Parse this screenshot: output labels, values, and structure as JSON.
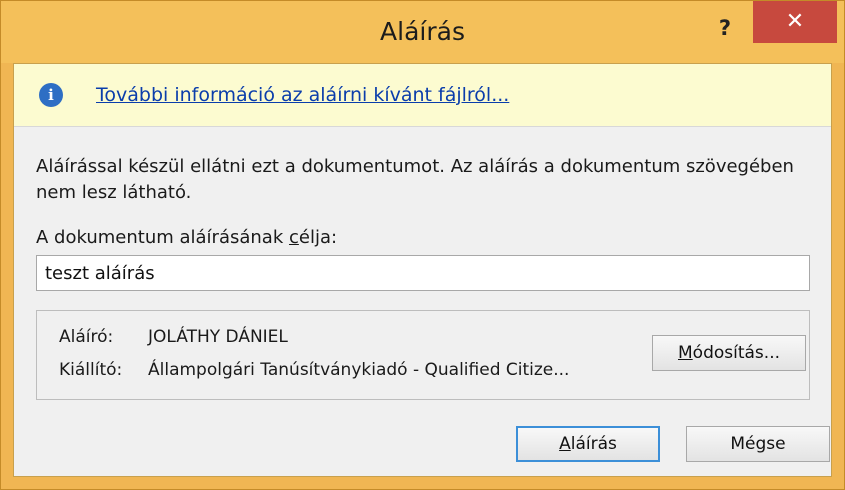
{
  "window": {
    "title": "Aláírás",
    "help_label": "?",
    "close_label": "✕"
  },
  "infobar": {
    "icon": "info-icon",
    "icon_glyph": "i",
    "link_text": "További információ az aláírni kívánt fájlról..."
  },
  "description": "Aláírással készül ellátni ezt a dokumentumot. Az aláírás a dokumentum szövegében nem lesz látható.",
  "purpose": {
    "label_pre": "A dokumentum aláírásának ",
    "label_accel": "c",
    "label_post": "élja:",
    "value": "teszt aláírás"
  },
  "signer": {
    "signer_label": "Aláíró:",
    "signer_value": "JOLÁTHY DÁNIEL",
    "issuer_label": "Kiállító:",
    "issuer_value": "Állampolgári Tanúsítványkiadó - Qualified Citize...",
    "modify_accel": "M",
    "modify_rest": "ódosítás..."
  },
  "buttons": {
    "sign_accel": "A",
    "sign_rest": "láírás",
    "cancel": "Mégse"
  },
  "colors": {
    "titlebar": "#f4c05a",
    "close": "#c7493e",
    "infobar": "#fcfbd0",
    "link": "#0a3dab",
    "default_button_border": "#3c8fd8"
  }
}
